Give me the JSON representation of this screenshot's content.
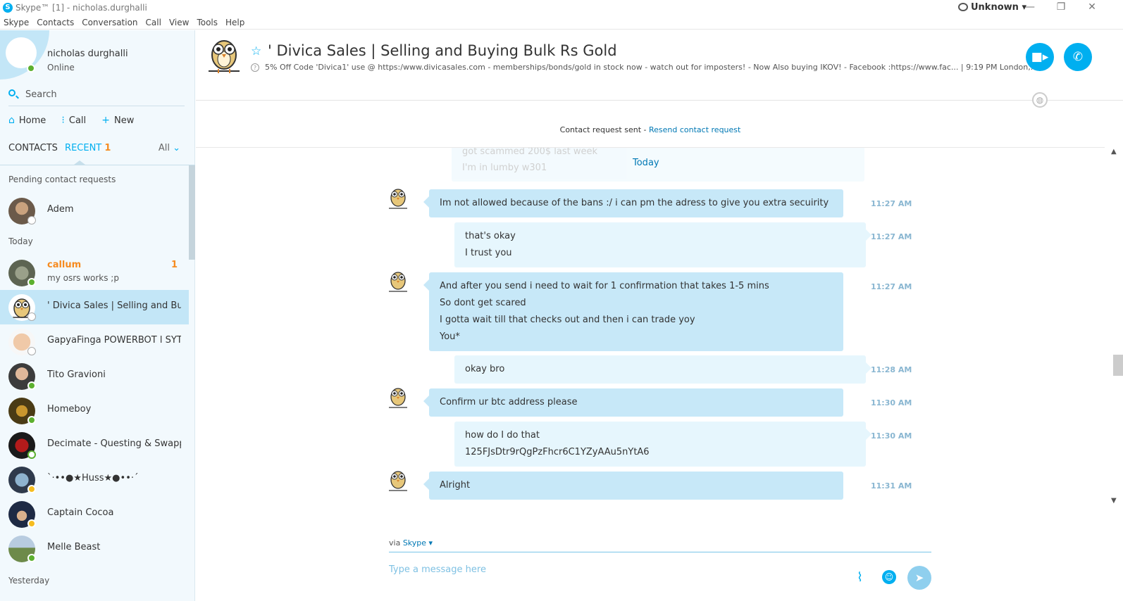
{
  "window": {
    "title": "Skype™ [1] - nicholas.durghalli",
    "status": "Unknown",
    "controls": [
      "—",
      "❐",
      "✕"
    ]
  },
  "menu": [
    "Skype",
    "Contacts",
    "Conversation",
    "Call",
    "View",
    "Tools",
    "Help"
  ],
  "profile": {
    "name": "nicholas durghalli",
    "status": "Online"
  },
  "search": {
    "placeholder": "Search"
  },
  "nav": {
    "home": "Home",
    "call": "Call",
    "new": "New"
  },
  "tabs": {
    "contacts": "CONTACTS",
    "recent": "RECENT",
    "recent_badge": "1",
    "filter": "All"
  },
  "sections": {
    "pending": "Pending contact requests",
    "today": "Today",
    "yesterday": "Yesterday"
  },
  "contacts": [
    {
      "name": "Adem",
      "presence": "unknown"
    },
    {
      "name": "callum",
      "sub": "my osrs works ;p",
      "count": "1",
      "presence": "online"
    },
    {
      "name": "' Divica Sales | Selling and Bu...",
      "presence": "unknown"
    },
    {
      "name": "GapyaFinga POWERBOT l SYT...",
      "presence": "unknown"
    },
    {
      "name": "Tito Gravioni",
      "presence": "online"
    },
    {
      "name": "Homeboy",
      "presence": "online"
    },
    {
      "name": "Decimate - Questing & Swapp...",
      "presence": "offline"
    },
    {
      "name": "`·••●★Huss★●••·´",
      "presence": "away"
    },
    {
      "name": "Captain Cocoa",
      "presence": "away"
    },
    {
      "name": "Melle Beast",
      "presence": "online"
    }
  ],
  "conversation": {
    "title": "' Divica Sales | Selling and Buying Bulk Rs Gold",
    "mood": "5% Off Code 'Divica1' use @ https:/www.divicasales.com - memberships/bonds/gold in stock now - watch out for imposters! - Now Also buying IKOV! - Facebook :https://www.fac...   |  9:19 PM London,...",
    "notice": "Contact request sent - ",
    "notice_link": "Resend contact request",
    "date_divider": "Today",
    "faded_lines": [
      "got scammed 200$ last week",
      "I'm in lumby w301"
    ]
  },
  "messages": [
    {
      "dir": "in",
      "lines": [
        "Im not allowed because of the bans :/ i can pm the adress to give you extra secuirity"
      ],
      "time": "11:27 AM"
    },
    {
      "dir": "out",
      "lines": [
        "that's okay",
        "I trust you"
      ],
      "time": "11:27 AM"
    },
    {
      "dir": "in",
      "lines": [
        "And after you send i need to wait for 1 confirmation that takes 1-5 mins",
        "So dont get scared",
        "I gotta wait till that checks out and then i can trade yoy",
        "You*"
      ],
      "time": "11:27 AM"
    },
    {
      "dir": "out",
      "lines": [
        "okay bro"
      ],
      "time": "11:28 AM"
    },
    {
      "dir": "in",
      "lines": [
        "Confirm ur btc address please"
      ],
      "time": "11:30 AM"
    },
    {
      "dir": "out",
      "lines": [
        "how do I do that",
        "125FJsDtr9rQgPzFhcr6C1YZyAAu5nYtA6"
      ],
      "time": "11:30 AM"
    },
    {
      "dir": "in",
      "lines": [
        "Alright"
      ],
      "time": "11:31 AM"
    }
  ],
  "compose": {
    "via": "via ",
    "via_service": "Skype",
    "placeholder": "Type a message here"
  },
  "colors": {
    "accent": "#00aff0",
    "unread": "#f68b1f",
    "incoming": "#c7e8f8",
    "outgoing": "#e6f6fd"
  }
}
